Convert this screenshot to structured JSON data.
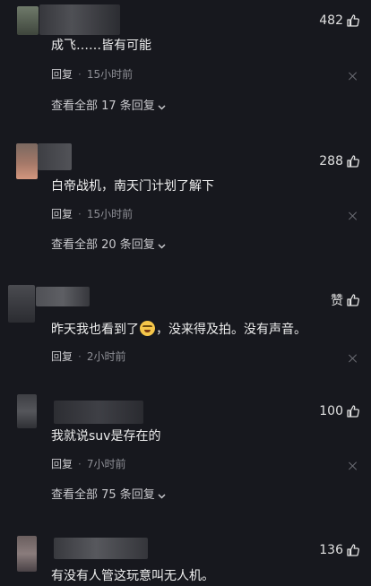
{
  "comments": [
    {
      "text": "成飞……皆有可能",
      "likes": "482",
      "reply_label": "回复",
      "time": "15小时前",
      "view_all": "查看全部 17 条回复"
    },
    {
      "text": "白帝战机，南天门计划了解下",
      "likes": "288",
      "reply_label": "回复",
      "time": "15小时前",
      "view_all": "查看全部 20 条回复"
    },
    {
      "text_before_emoji": "昨天我也看到了",
      "text_after_emoji": "，没来得及拍。没有声音。",
      "likes": "赞",
      "reply_label": "回复",
      "time": "2小时前"
    },
    {
      "text": "我就说suv是存在的",
      "likes": "100",
      "reply_label": "回复",
      "time": "7小时前",
      "view_all": "查看全部 75 条回复"
    },
    {
      "text": "有没有人管这玩意叫无人机。",
      "likes": "136"
    }
  ],
  "icons": {
    "like": "thumbs-up-icon",
    "dismiss": "close-icon",
    "expand": "chevron-down-icon",
    "emoji": "crying-laughing-emoji"
  },
  "colors": {
    "background": "#17181e",
    "text": "#eeeeee",
    "meta": "#8e8f96"
  }
}
